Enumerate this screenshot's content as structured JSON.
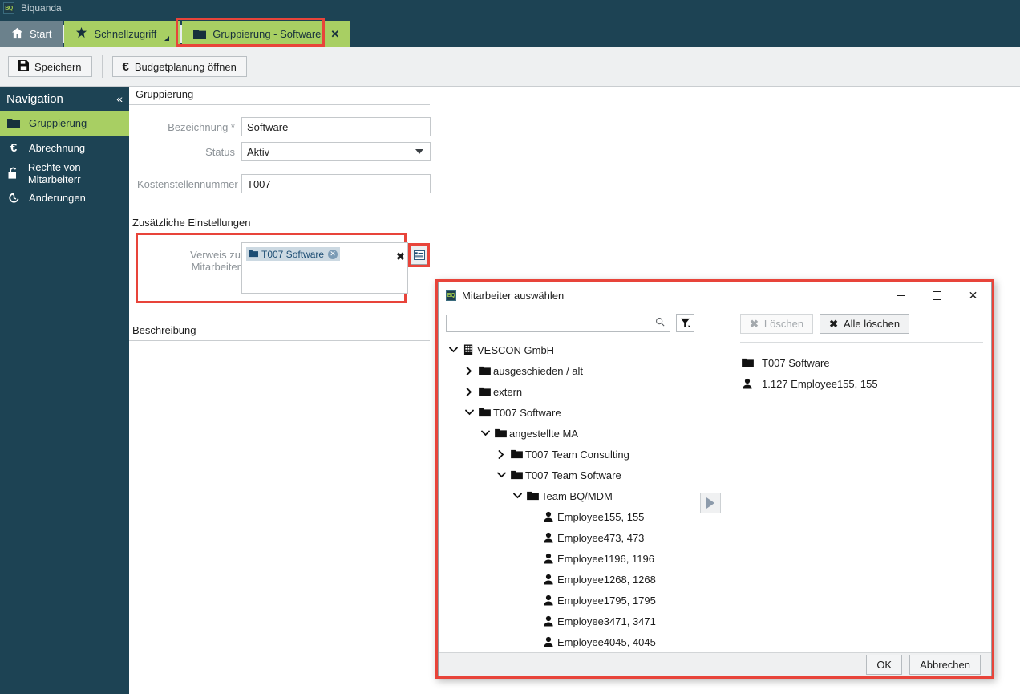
{
  "window": {
    "app_name": "Biquanda",
    "logo_text": "BQ"
  },
  "tabs": [
    {
      "label": "Start",
      "icon": "home-icon",
      "state": "inactive-start"
    },
    {
      "label": "Schnellzugriff",
      "icon": "star-icon",
      "state": "green"
    },
    {
      "label": "Gruppierung - Software",
      "icon": "folder-icon",
      "state": "green-active",
      "closable": true
    }
  ],
  "ribbon": {
    "save_label": "Speichern",
    "save_icon": "save-icon",
    "budget_label": "Budgetplanung öffnen",
    "budget_icon": "euro-icon"
  },
  "sidebar": {
    "title": "Navigation",
    "collapse_icon": "«",
    "items": [
      {
        "label": "Gruppierung",
        "icon": "folder-icon",
        "active": true
      },
      {
        "label": "Abrechnung",
        "icon": "euro-icon",
        "active": false
      },
      {
        "label": "Rechte von Mitarbeiterr",
        "icon": "lock-icon",
        "active": false
      },
      {
        "label": "Änderungen",
        "icon": "history-icon",
        "active": false
      }
    ]
  },
  "form": {
    "section_gruppierung": "Gruppierung",
    "bezeichnung_label": "Bezeichnung *",
    "bezeichnung_value": "Software",
    "status_label": "Status",
    "status_value": "Aktiv",
    "kostenstelle_label": "Kostenstellennummer",
    "kostenstelle_value": "T007",
    "section_zusatz": "Zusätzliche Einstellungen",
    "verweis_label": "Verweis zu Mitarbeiter",
    "verweis_chip": "T007 Software",
    "verweis_chip_remove": "✕",
    "verweis_clear": "✖",
    "verweis_picker_icon": "list-picker-icon",
    "section_beschreibung": "Beschreibung"
  },
  "dialog": {
    "title": "Mitarbeiter auswählen",
    "logo_text": "BQ",
    "minimize_icon": "minimize-icon",
    "maximize_icon": "maximize-icon",
    "close_icon": "close-icon",
    "search_placeholder": "",
    "search_value": "",
    "search_icon": "search-icon",
    "filter_icon": "filter-icon",
    "delete_button": {
      "label": "Löschen",
      "icon": "x-icon",
      "disabled": true
    },
    "delete_all_button": {
      "label": "Alle löschen",
      "icon": "x-icon",
      "disabled": false
    },
    "transfer_icon": "arrow-right-icon",
    "tree": [
      {
        "label": "VESCON GmbH",
        "depth": 0,
        "icon": "building-icon",
        "expander": "down"
      },
      {
        "label": "ausgeschieden / alt",
        "depth": 1,
        "icon": "folder-icon",
        "expander": "right"
      },
      {
        "label": "extern",
        "depth": 1,
        "icon": "folder-icon",
        "expander": "right"
      },
      {
        "label": "T007 Software",
        "depth": 1,
        "icon": "folder-icon",
        "expander": "down"
      },
      {
        "label": "angestellte MA",
        "depth": 2,
        "icon": "folder-icon",
        "expander": "down"
      },
      {
        "label": "T007 Team Consulting",
        "depth": 3,
        "icon": "folder-icon",
        "expander": "right"
      },
      {
        "label": "T007 Team Software",
        "depth": 3,
        "icon": "folder-icon",
        "expander": "down"
      },
      {
        "label": "Team BQ/MDM",
        "depth": 4,
        "icon": "folder-icon",
        "expander": "down"
      },
      {
        "label": "Employee155, 155",
        "depth": 5,
        "icon": "person-icon",
        "expander": "none"
      },
      {
        "label": "Employee473, 473",
        "depth": 5,
        "icon": "person-icon",
        "expander": "none"
      },
      {
        "label": "Employee1196, 1196",
        "depth": 5,
        "icon": "person-icon",
        "expander": "none"
      },
      {
        "label": "Employee1268, 1268",
        "depth": 5,
        "icon": "person-icon",
        "expander": "none"
      },
      {
        "label": "Employee1795, 1795",
        "depth": 5,
        "icon": "person-icon",
        "expander": "none"
      },
      {
        "label": "Employee3471, 3471",
        "depth": 5,
        "icon": "person-icon",
        "expander": "none"
      },
      {
        "label": "Employee4045, 4045",
        "depth": 5,
        "icon": "person-icon",
        "expander": "none"
      }
    ],
    "selected": [
      {
        "label": "T007 Software",
        "icon": "folder-icon"
      },
      {
        "label": "1.127 Employee155, 155",
        "icon": "person-icon"
      }
    ],
    "ok_label": "OK",
    "cancel_label": "Abbrechen"
  },
  "colors": {
    "dark_teal": "#1d4354",
    "green": "#a8cf63",
    "highlight_red": "#e8443a",
    "chip_bg": "#ccd9e2",
    "chip_text": "#1d4d73"
  }
}
